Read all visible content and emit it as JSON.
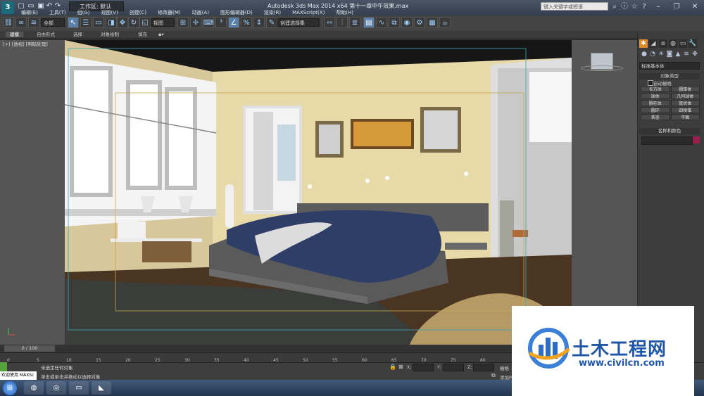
{
  "titlebar": {
    "window_title": "Autodesk 3ds Max  2014 x64     第十一章中午效果.max",
    "workspace": "工作区: 默认",
    "search_placeholder": "键入关键字或短语",
    "logo": "3"
  },
  "menu": [
    "编辑(E)",
    "工具(T)",
    "组(G)",
    "视图(V)",
    "创建(C)",
    "修改器(M)",
    "动画(A)",
    "图形编辑器(D)",
    "渲染(R)",
    "MAXScript(X)",
    "帮助(H)"
  ],
  "toolbar": {
    "selection_filter": "全部",
    "ref_coord": "视图",
    "named_sel": "创建选择集"
  },
  "ribbon_tabs": [
    "建模",
    "自由形式",
    "选择",
    "对象绘制",
    "填充"
  ],
  "viewport": {
    "label": "[+] [透视] [明暗处理]"
  },
  "command_panel": {
    "primitive_type": "标准基本体",
    "object_type_header": "对象类型",
    "autogrid": "自动栅格",
    "object_buttons": [
      "长方体",
      "圆锥体",
      "球体",
      "几何球体",
      "圆柱体",
      "管状体",
      "圆环",
      "四棱锥",
      "茶壶",
      "平面"
    ],
    "name_color_header": "名称和颜色",
    "name_color_hex": "#9b1f4e"
  },
  "timeline": {
    "slider": "0 / 100",
    "ticks": [
      "0",
      "5",
      "10",
      "15",
      "20",
      "25",
      "30",
      "35",
      "40",
      "45",
      "50",
      "55",
      "60",
      "65",
      "70",
      "75",
      "80"
    ]
  },
  "status": {
    "maxscript": "欢迎使用 MAXSc",
    "line1": "未选定任何对象",
    "line2": "单击或单击并拖动以选择对象",
    "x_label": "X:",
    "y_label": "Y:",
    "z_label": "Z:",
    "grid": "栅格",
    "add_time_tag": "添加时"
  },
  "watermark": {
    "title": "土木工程网",
    "url": "www.civilcn.com"
  }
}
